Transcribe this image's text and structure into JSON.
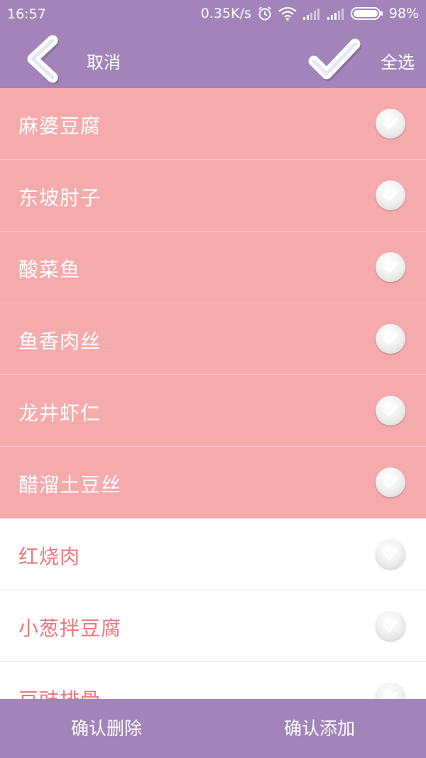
{
  "status_bar": {
    "time": "16:57",
    "speed": "0.35K/s",
    "battery": "98%",
    "icons": [
      "alarm-icon",
      "wifi-icon",
      "signal-icon",
      "signal-icon",
      "battery-icon"
    ]
  },
  "toolbar": {
    "back_icon": "back-chevron-icon",
    "cancel_label": "取消",
    "check_icon": "checkmark-icon",
    "select_all_label": "全选"
  },
  "dishes": [
    {
      "name": "麻婆豆腐",
      "selected": true
    },
    {
      "name": "东坡肘子",
      "selected": true
    },
    {
      "name": "酸菜鱼",
      "selected": true
    },
    {
      "name": "鱼香肉丝",
      "selected": true
    },
    {
      "name": "龙井虾仁",
      "selected": true
    },
    {
      "name": "醋溜土豆丝",
      "selected": true
    },
    {
      "name": "红烧肉",
      "selected": false
    },
    {
      "name": "小葱拌豆腐",
      "selected": false
    },
    {
      "name": "豆豉排骨",
      "selected": false
    }
  ],
  "bottom": {
    "delete_label": "确认删除",
    "add_label": "确认添加"
  },
  "colors": {
    "primary": "#a284ba",
    "selected_row": "#f5aaab",
    "unselected_text": "#f07679"
  }
}
